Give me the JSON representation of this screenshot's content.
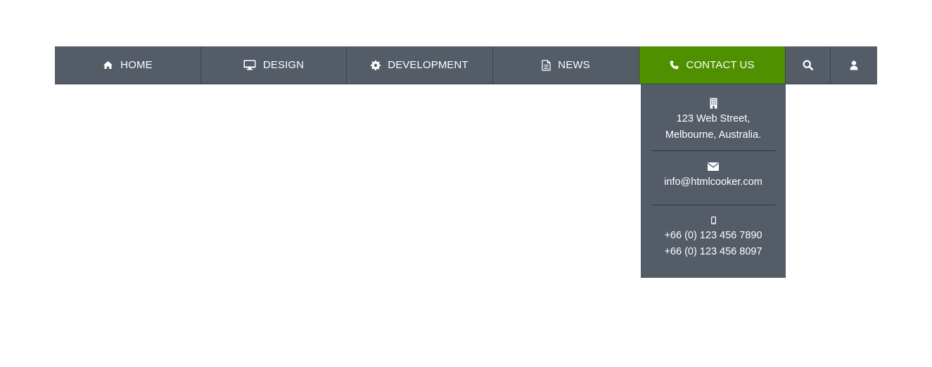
{
  "nav": {
    "items": [
      {
        "label": "HOME",
        "icon": "home-icon"
      },
      {
        "label": "DESIGN",
        "icon": "desktop-icon"
      },
      {
        "label": "DEVELOPMENT",
        "icon": "gear-icon"
      },
      {
        "label": "NEWS",
        "icon": "document-icon"
      },
      {
        "label": "CONTACT US",
        "icon": "phone-icon",
        "active": true
      }
    ],
    "search_icon": "search-icon",
    "user_icon": "user-icon"
  },
  "contact_dropdown": {
    "address": {
      "icon": "building-icon",
      "line1": "123 Web Street,",
      "line2": "Melbourne, Australia."
    },
    "email": {
      "icon": "envelope-icon",
      "value": "info@htmlcooker.com"
    },
    "phone": {
      "icon": "mobile-icon",
      "line1": "+66 (0) 123 456 7890",
      "line2": "+66 (0) 123 456 8097"
    }
  },
  "colors": {
    "nav_bg": "#545c68",
    "active_bg": "#4f9000",
    "divider": "#3d434c",
    "text": "#ffffff"
  }
}
